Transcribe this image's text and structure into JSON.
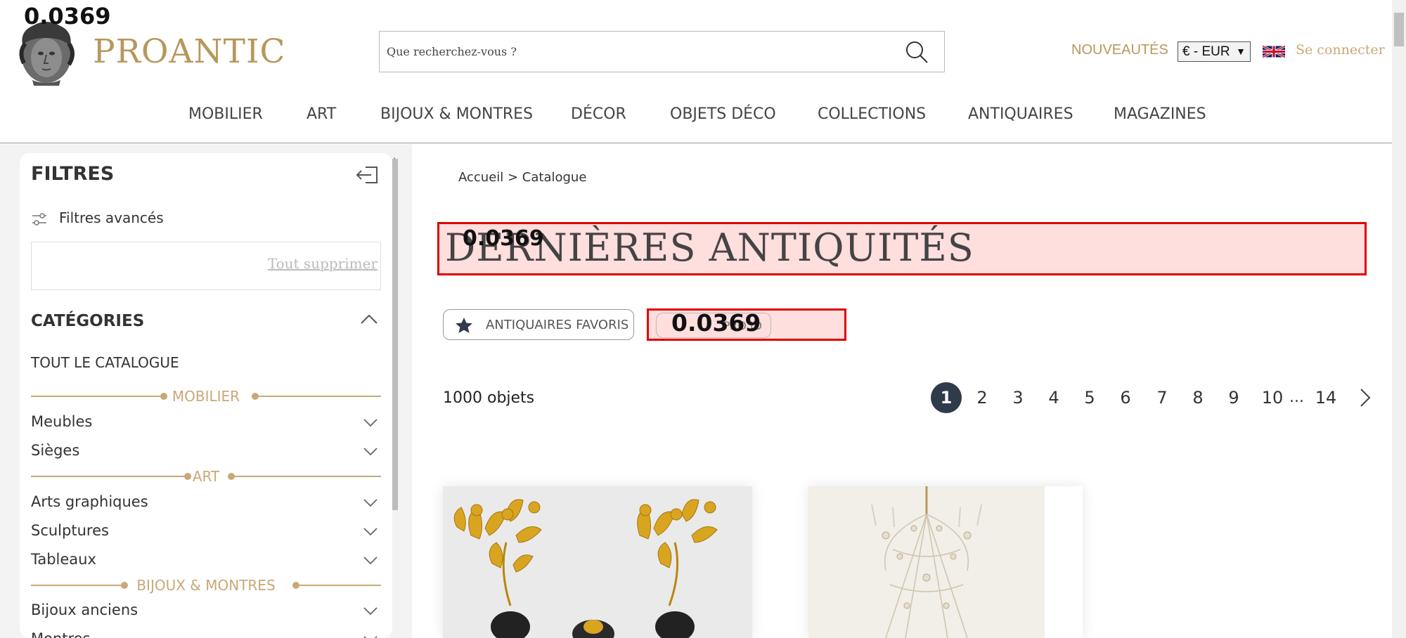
{
  "overlay_labels": {
    "top_left": "0.0369",
    "title": "0.0369",
    "pro_button": "0.0369"
  },
  "header": {
    "logo_text": "PROANTIC",
    "search_placeholder": "Que recherchez-vous ?",
    "nouveautes": "NOUVEAUTÉS",
    "currency": "€ - EUR",
    "login": "Se connecter"
  },
  "nav": {
    "items": [
      "MOBILIER",
      "ART",
      "BIJOUX & MONTRES",
      "DÉCOR",
      "OBJETS DÉCO",
      "COLLECTIONS",
      "ANTIQUAIRES",
      "MAGAZINES"
    ]
  },
  "sidebar": {
    "title": "FILTRES",
    "advanced": "Filtres avancés",
    "clear_all": "Tout supprimer",
    "categories_title": "CATÉGORIES",
    "all_catalog": "TOUT LE CATALOGUE",
    "sections": {
      "mobilier": "MOBILIER",
      "art": "ART",
      "bijoux": "BIJOUX & MONTRES"
    },
    "items": {
      "meubles": "Meubles",
      "sieges": "Sièges",
      "arts_graphiques": "Arts graphiques",
      "sculptures": "Sculptures",
      "tableaux": "Tableaux",
      "bijoux_anciens": "Bijoux anciens",
      "montres": "Montres"
    }
  },
  "main": {
    "breadcrumb": "Accueil > Catalogue",
    "title": "DERNIÈRES ANTIQUITÉS",
    "fav_button": "ANTIQUAIRES FAVORIS",
    "pro_button": "PRO ID",
    "count": "1000 objets",
    "pagination": {
      "pages": [
        "1",
        "2",
        "3",
        "4",
        "5",
        "6",
        "7",
        "8",
        "9",
        "10"
      ],
      "ellipsis": "...",
      "last": "14",
      "current": 1
    }
  },
  "colors": {
    "gold": "#b8975c",
    "dark_page": "#2f3a4b",
    "highlight": "#e00000"
  }
}
